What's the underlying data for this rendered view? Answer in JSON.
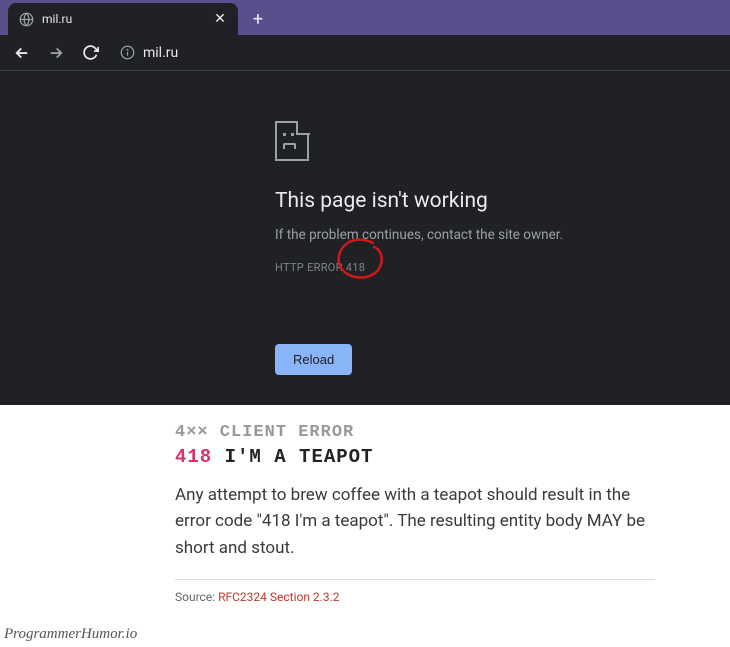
{
  "browser": {
    "tab_title": "mil.ru",
    "url": "mil.ru",
    "nav": {
      "back": "←",
      "forward": "→",
      "reload_glyph": "⟳"
    }
  },
  "error_page": {
    "title": "This page isn't working",
    "subtitle": "If the problem continues, contact the site owner.",
    "code": "HTTP ERROR 418",
    "reload_label": "Reload"
  },
  "rfc": {
    "category": "4×× CLIENT ERROR",
    "code": "418",
    "name": "I'M A TEAPOT",
    "body": "Any attempt to brew coffee with a teapot should result in the error code \"418 I'm a teapot\". The resulting entity body MAY be short and stout.",
    "source_label": "Source: ",
    "source_link": "RFC2324 Section 2.3.2"
  },
  "watermark": "ProgrammerHumor.io",
  "colors": {
    "tab_bar": "#5b4e8c",
    "chrome_bg": "#202124",
    "accent_blue": "#8ab4f8",
    "annotation_red": "#c21919",
    "rfc_code": "#d6336c"
  }
}
